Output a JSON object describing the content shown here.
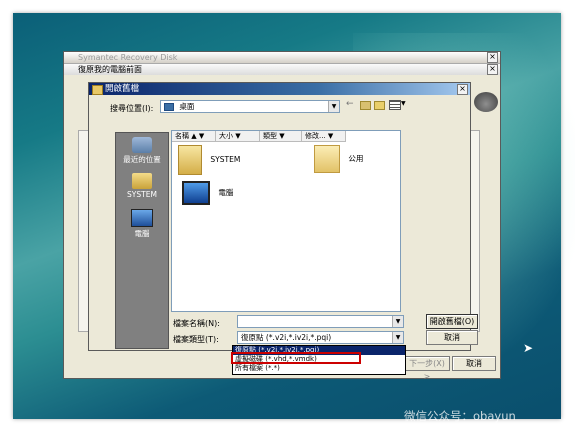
{
  "background_window": {
    "title": "Symantec Recovery Disk",
    "subtitle": "復原我的電腦前面"
  },
  "dialog": {
    "title": "開啟舊檔",
    "look_in_label": "搜尋位置(I):",
    "look_in_value": "桌面",
    "places": [
      {
        "label": "最近的位置"
      },
      {
        "label": "SYSTEM"
      },
      {
        "label": "電腦"
      }
    ],
    "columns": [
      "名稱",
      "大小",
      "類型",
      "修改..."
    ],
    "files": [
      {
        "name": "SYSTEM"
      },
      {
        "name": "公用"
      },
      {
        "name": "電腦"
      }
    ],
    "file_name_label": "檔案名稱(N):",
    "file_name_value": "",
    "file_type_label": "檔案類型(T):",
    "file_type_value": "復原點 (*.v2i,*.iv2i,*.pqi)",
    "open_button": "開啟舊檔(O)",
    "cancel_button": "取消",
    "file_type_options": [
      "復原點 (*.v2i,*.iv2i,*.pqi)",
      "虛擬磁碟 (*.vhd,*.vmdk)",
      "所有檔案 (*.*)"
    ]
  },
  "background_buttons": {
    "next": "下一步(X) >",
    "cancel": "取消"
  },
  "watermark": "微信公众号：obayun",
  "colors": {
    "highlight": "#0a246a",
    "selection_box": "#cc0000"
  }
}
